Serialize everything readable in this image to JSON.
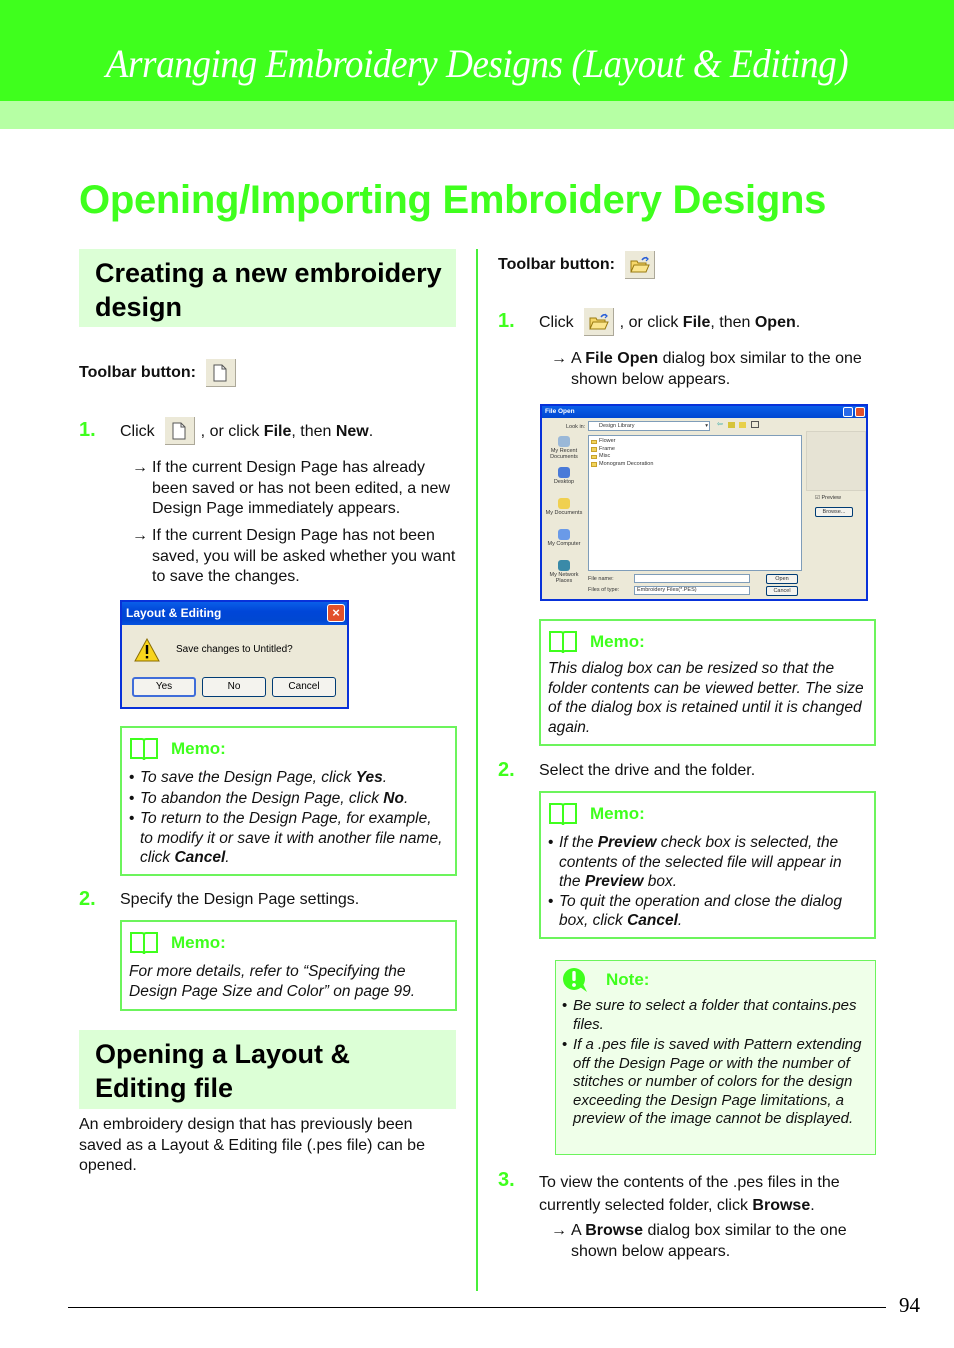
{
  "banner": {
    "title": "Arranging Embroidery Designs (Layout & Editing)"
  },
  "page_title": "Opening/Importing Embroidery Designs",
  "left": {
    "section1": {
      "heading": "Creating a new embroidery design",
      "toolbar_label": "Toolbar button:",
      "toolbar_icon": "new-document-icon",
      "step1": {
        "num": "1.",
        "pre": "Click",
        "mid": ", or click",
        "menu1": "File",
        "then": ", then",
        "menu2": "New",
        "end": ".",
        "results": [
          "If the current Design Page has already been saved or has not been edited, a new Design Page immediately appears.",
          "If the current Design Page has not been saved, you will be asked whether you want to save the changes."
        ]
      },
      "dialog": {
        "title": "Layout & Editing",
        "message": "Save changes to Untitled?",
        "buttons": [
          "Yes",
          "No",
          "Cancel"
        ],
        "close_label": "×"
      },
      "memo1": {
        "title": "Memo:",
        "items": [
          {
            "pre": "To save the Design Page, click ",
            "bold": "Yes",
            "post": "."
          },
          {
            "pre": "To abandon the Design Page, click ",
            "bold": "No",
            "post": "."
          },
          {
            "pre": "To return to the Design Page, for example, to modify it or save it with another file name, click ",
            "bold": "Cancel",
            "post": "."
          }
        ]
      },
      "step2": {
        "num": "2.",
        "text": "Specify the Design Page settings."
      },
      "memo2": {
        "title": "Memo:",
        "text": "For more details, refer to “Specifying the Design Page Size and Color” on page 99."
      }
    },
    "section2": {
      "heading": "Opening a Layout & Editing file",
      "body": "An embroidery design that has previously been saved as a Layout & Editing file (.pes file) can be opened."
    }
  },
  "right": {
    "toolbar_label": "Toolbar button:",
    "toolbar_icon": "open-folder-icon",
    "step1": {
      "num": "1.",
      "pre": "Click",
      "mid": ", or click",
      "menu1": "File",
      "then": ", then",
      "menu2": "Open",
      "end": ".",
      "result_pre": "A ",
      "result_bold": "File Open",
      "result_post": " dialog box similar to the one shown below appears."
    },
    "file_open_dialog": {
      "title": "File Open",
      "look_in_label": "Look in:",
      "look_in_value": "Design Library",
      "folders": [
        "Flower",
        "Frame",
        "Misc",
        "Monogram Decoration"
      ],
      "places": [
        "My Recent Documents",
        "Desktop",
        "My Documents",
        "My Computer",
        "My Network Places"
      ],
      "file_name_label": "File name:",
      "file_name_value": "",
      "file_type_label": "Files of type:",
      "file_type_value": "Embroidery Files(*.PES)",
      "preview_label": "Preview",
      "preview_checked": true,
      "browse_label": "Browse...",
      "open_label": "Open",
      "cancel_label": "Cancel"
    },
    "memo1": {
      "title": "Memo:",
      "text": "This dialog box can be resized so that the folder contents can be viewed better. The size of the dialog box is retained until it is changed again."
    },
    "step2": {
      "num": "2.",
      "text": "Select the drive and the folder."
    },
    "memo2": {
      "title": "Memo:",
      "items": [
        {
          "pre": "If the ",
          "bold": "Preview",
          "mid": " check box is selected, the contents of the selected file will appear in the ",
          "bold2": "Preview",
          "post": " box."
        },
        {
          "pre": "To quit the operation and close the dialog box, click ",
          "bold": "Cancel",
          "post": "."
        }
      ]
    },
    "note": {
      "title": "Note:",
      "items": [
        "Be sure to select a folder that contains.pes files.",
        "If a .pes file is saved with Pattern extending off the Design Page or with the number of stitches or number of colors for the design exceeding the Design Page limitations, a preview of the image cannot be displayed."
      ]
    },
    "step3": {
      "num": "3.",
      "pre": "To view the contents of the .pes files in the currently selected folder, click ",
      "bold": "Browse",
      "post": ".",
      "result_pre": "A ",
      "result_bold": "Browse",
      "result_post": " dialog box similar to the one shown below appears."
    }
  },
  "footer": {
    "page_number": "94"
  },
  "colors": {
    "accent_green": "#3fff1d",
    "band_green": "#b6ffa4",
    "section_bg": "#dcffd6",
    "memo_border": "#6cf45c"
  }
}
